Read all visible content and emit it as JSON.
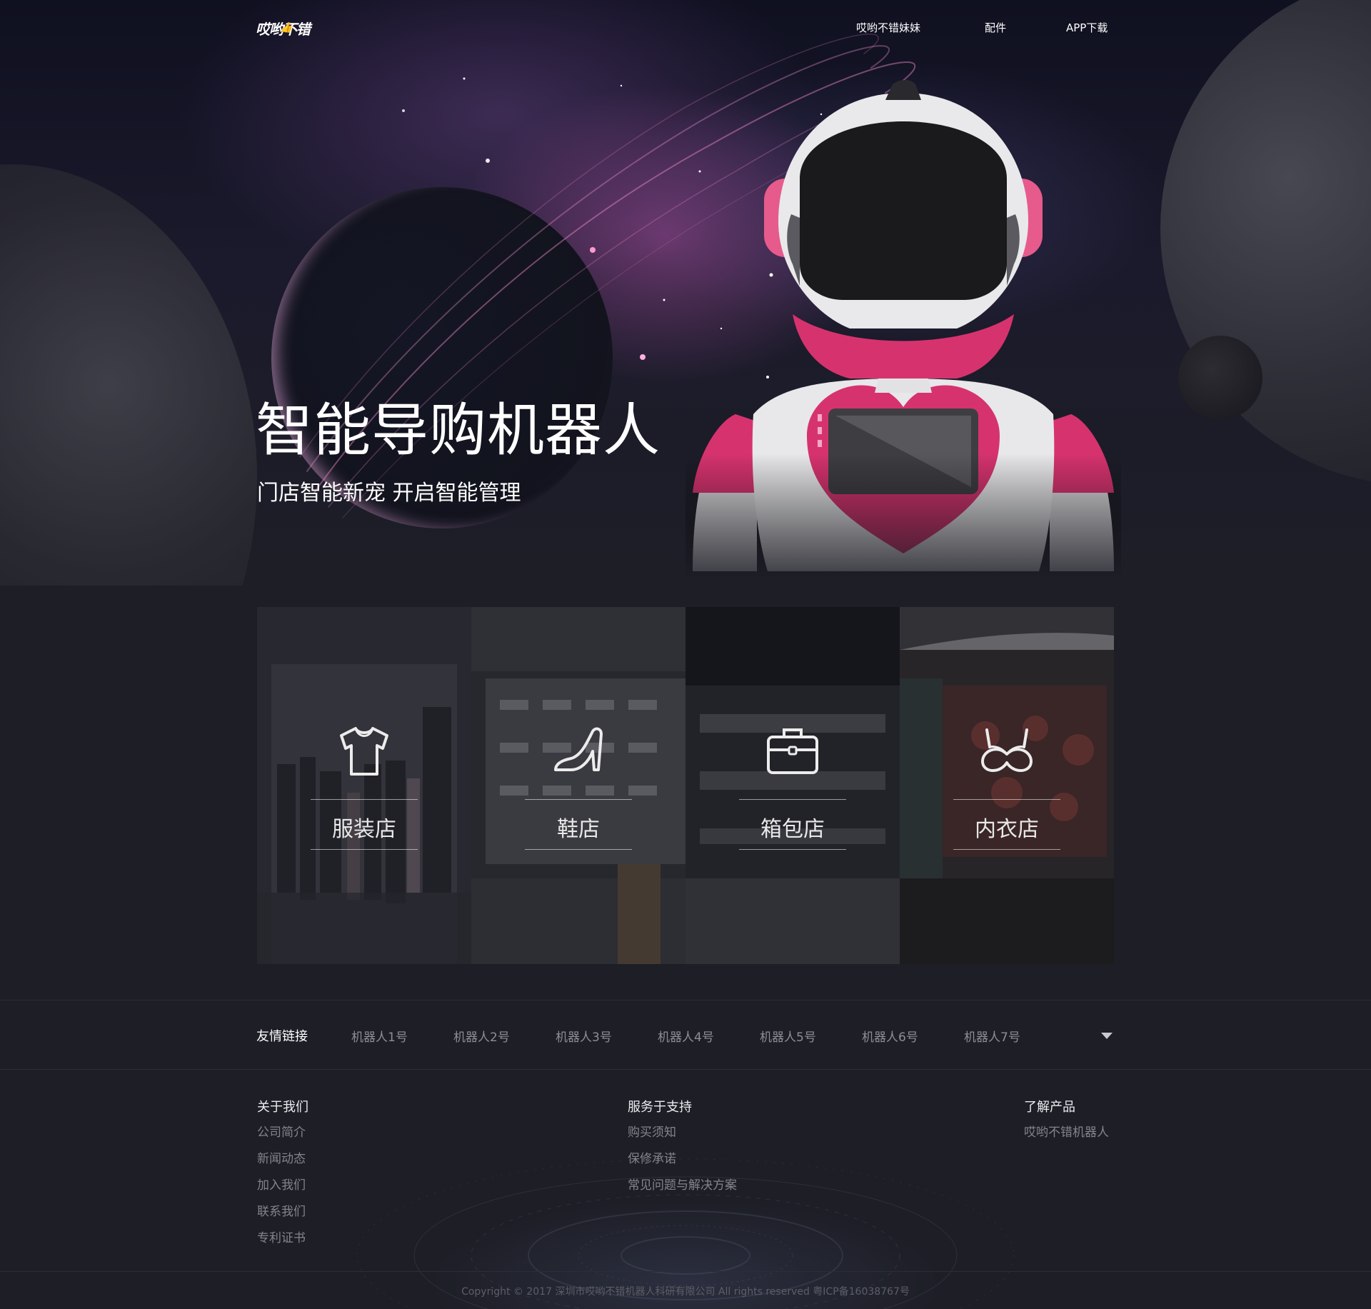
{
  "brand": {
    "logo_text": "哎哟不错"
  },
  "nav": {
    "items": [
      {
        "label": "哎哟不错妹妹"
      },
      {
        "label": "配件"
      },
      {
        "label": "APP下载"
      }
    ]
  },
  "hero": {
    "title": "智能导购机器人",
    "subtitle": "门店智能新宠 开启智能管理"
  },
  "stores": [
    {
      "label": "服装店",
      "icon": "tshirt-icon"
    },
    {
      "label": "鞋店",
      "icon": "high-heel-icon"
    },
    {
      "label": "箱包店",
      "icon": "briefcase-icon"
    },
    {
      "label": "内衣店",
      "icon": "bra-icon"
    }
  ],
  "friend_links": {
    "title": "友情链接",
    "items": [
      "机器人1号",
      "机器人2号",
      "机器人3号",
      "机器人4号",
      "机器人5号",
      "机器人6号",
      "机器人7号"
    ],
    "expand_icon": "caret-down-icon"
  },
  "footer": {
    "columns": [
      {
        "title": "关于我们",
        "links": [
          "公司简介",
          "新闻动态",
          "加入我们",
          "联系我们",
          "专利证书"
        ]
      },
      {
        "title": "服务于支持",
        "links": [
          "购买须知",
          "保修承诺",
          "常见问题与解决方案"
        ]
      },
      {
        "title": "了解产品",
        "links": [
          "哎哟不错机器人"
        ]
      }
    ],
    "copyright": "Copyright © 2017 深圳市哎哟不错机器人科研有限公司 All rights reserved 粤ICP备16038767号"
  },
  "colors": {
    "background": "#1d1e26",
    "robot_pink": "#d6336e",
    "muted_text": "#83848c"
  }
}
